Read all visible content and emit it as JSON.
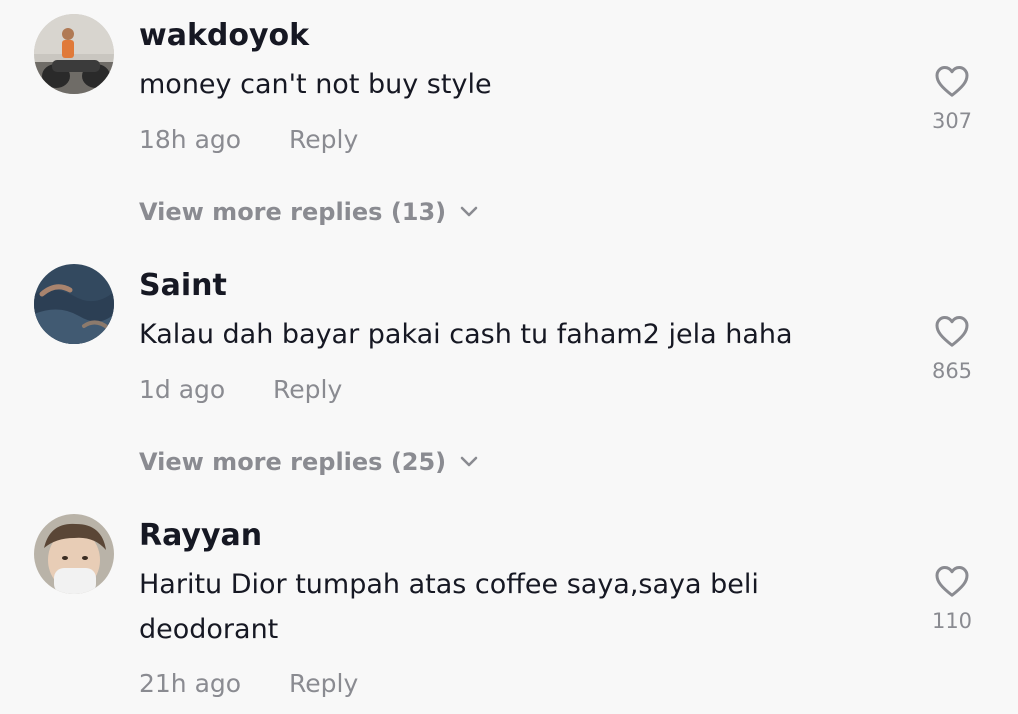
{
  "comments": [
    {
      "username": "wakdoyok",
      "text": "money can't not buy style",
      "time": "18h ago",
      "reply_label": "Reply",
      "likes": "307",
      "view_more": "View more replies (13)",
      "avatar_icon": "user-avatar-motorcycle"
    },
    {
      "username": "Saint",
      "text": "Kalau dah bayar pakai cash tu faham2 jela haha",
      "time": "1d ago",
      "reply_label": "Reply",
      "likes": "865",
      "view_more": "View more replies (25)",
      "avatar_icon": "user-avatar-ocean"
    },
    {
      "username": "Rayyan",
      "text": "Haritu Dior tumpah atas coffee saya,saya beli deodorant",
      "time": "21h ago",
      "reply_label": "Reply",
      "likes": "110",
      "avatar_icon": "user-avatar-portrait"
    }
  ],
  "icons": {
    "like": "heart-outline-icon",
    "expand": "chevron-down-icon"
  },
  "colors": {
    "background": "#f8f8f8",
    "primary_text": "#161823",
    "secondary_text": "#8a8b91"
  }
}
